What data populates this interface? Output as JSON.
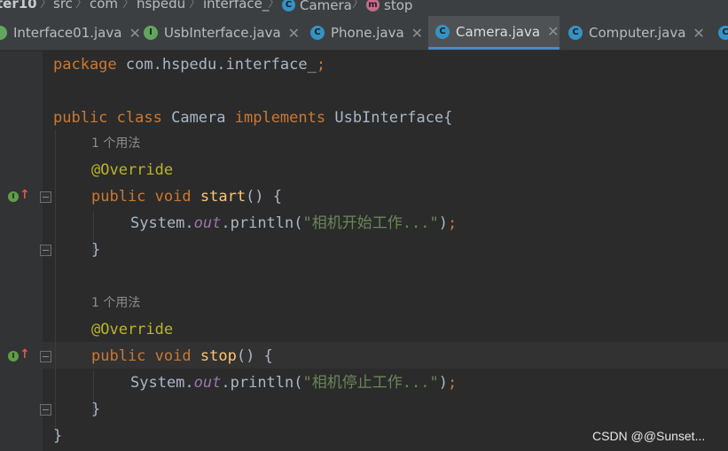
{
  "breadcrumb": {
    "items": [
      {
        "label": "ter10"
      },
      {
        "label": "src"
      },
      {
        "label": "com"
      },
      {
        "label": "hspedu"
      },
      {
        "label": "interface_"
      },
      {
        "label": "Camera",
        "icon": "class-icon"
      },
      {
        "label": "stop",
        "icon": "method-icon"
      }
    ]
  },
  "tabs": [
    {
      "label": "Interface01.java",
      "icon": "java-class-icon",
      "active": false
    },
    {
      "label": "UsbInterface.java",
      "icon": "interface-icon",
      "active": false
    },
    {
      "label": "Phone.java",
      "icon": "class-icon",
      "active": false
    },
    {
      "label": "Camera.java",
      "icon": "class-icon",
      "active": true
    },
    {
      "label": "Computer.java",
      "icon": "class-icon",
      "active": false
    }
  ],
  "code": {
    "line1": {
      "kw": "package",
      "rest": " com.hspedu.interface_",
      "semi": ";"
    },
    "line3": {
      "kw1": "public",
      "kw2": "class",
      "name": " Camera ",
      "kw3": "implements",
      "rest": " UsbInterface{"
    },
    "hint1": "1 个用法",
    "line4": {
      "ann": "@Override"
    },
    "line5": {
      "kw1": "public",
      "kw2": "void",
      "fn": "start",
      "rest": "() {"
    },
    "line6": {
      "pre": "System.",
      "field": "out",
      "mid": ".println(",
      "str": "\"相机开始工作...\"",
      "post": ")",
      "semi": ";"
    },
    "line7": {
      "text": "}"
    },
    "hint2": "1 个用法",
    "line9": {
      "ann": "@Override"
    },
    "line10": {
      "kw1": "public",
      "kw2": "void",
      "fn": "stop",
      "rest": "() {"
    },
    "line11": {
      "pre": "System.",
      "field": "out",
      "mid": ".println(",
      "str": "\"相机停止工作...\"",
      "post": ")",
      "semi": ";"
    },
    "line12": {
      "text": "}"
    },
    "line13": {
      "text": "}"
    }
  },
  "watermark": "CSDN @@Sunset...",
  "colors": {
    "background": "#2b2b2b",
    "keyword": "#cc7832",
    "annotation": "#bbb529",
    "method": "#ffc66d",
    "field": "#9876aa",
    "string": "#6a8759",
    "active_tab_underline": "#4a88c7"
  }
}
